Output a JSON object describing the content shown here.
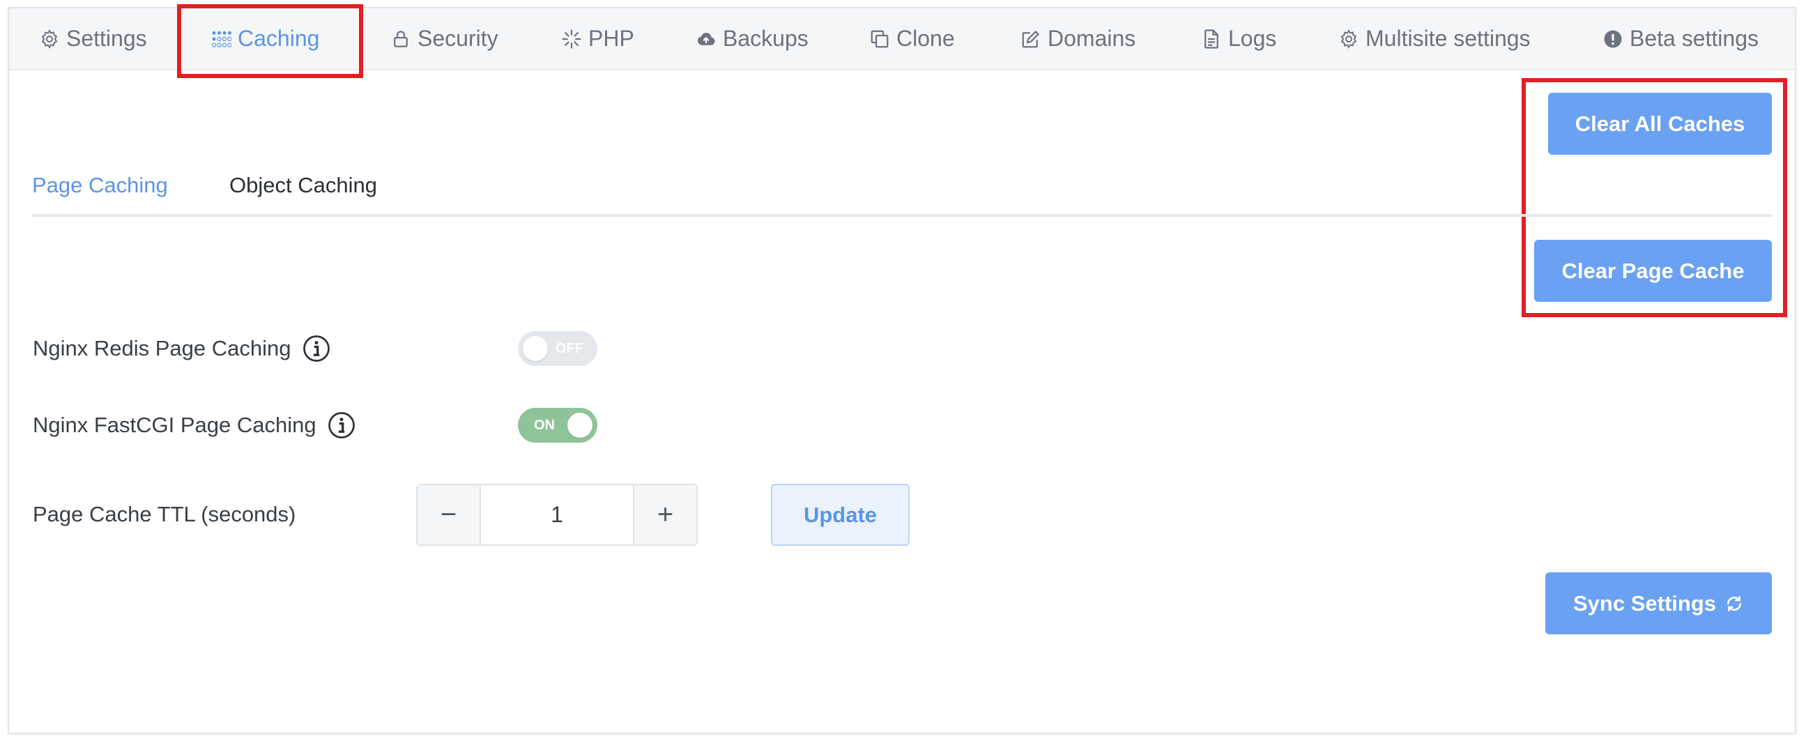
{
  "tabs": [
    {
      "label": "Settings",
      "icon": "gear-icon"
    },
    {
      "label": "Caching",
      "icon": "grid-dots-icon"
    },
    {
      "label": "Security",
      "icon": "lock-icon"
    },
    {
      "label": "PHP",
      "icon": "spinner-icon"
    },
    {
      "label": "Backups",
      "icon": "cloud-upload-icon"
    },
    {
      "label": "Clone",
      "icon": "copy-icon"
    },
    {
      "label": "Domains",
      "icon": "edit-icon"
    },
    {
      "label": "Logs",
      "icon": "document-icon"
    },
    {
      "label": "Multisite settings",
      "icon": "gear-icon"
    },
    {
      "label": "Beta settings",
      "icon": "alert-circle-icon"
    }
  ],
  "active_tab": "Caching",
  "actions": {
    "clear_all_caches": "Clear All Caches",
    "clear_page_cache": "Clear Page Cache",
    "sync_settings": "Sync Settings"
  },
  "subtabs": [
    {
      "label": "Page Caching",
      "active": true
    },
    {
      "label": "Object Caching",
      "active": false
    }
  ],
  "settings": {
    "redis": {
      "label": "Nginx Redis Page Caching",
      "state": "OFF",
      "enabled": false
    },
    "fastcgi": {
      "label": "Nginx FastCGI Page Caching",
      "state": "ON",
      "enabled": true
    },
    "ttl": {
      "label": "Page Cache TTL (seconds)",
      "value": "1",
      "minus": "−",
      "plus": "+",
      "update_label": "Update"
    }
  },
  "colors": {
    "accent": "#5b95e5",
    "button": "#6aa1f2",
    "toggle_on": "#8fc49a",
    "highlight": "#e31e24"
  }
}
